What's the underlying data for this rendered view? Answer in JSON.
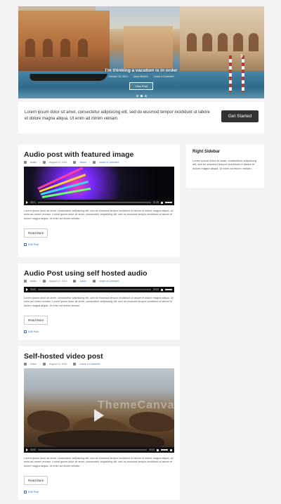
{
  "slider": {
    "title": "I'm thinking a vacation is in order",
    "meta": [
      "October 16, 2014",
      "Jason Bobich",
      "Leave a Comment"
    ],
    "button": "View Post",
    "next_icon": "chevron-right-icon",
    "dots": 3,
    "active_dot": 1
  },
  "cta": {
    "text": "Lorem ipsum dolor sit amet, consectetur adipisicing elit, sed do eiusmod tempor incididunt ut labore et dolore magna aliqua. Ut enim ad minim veniam.",
    "button": "Get Started"
  },
  "posts": [
    {
      "title": "Audio post with featured image",
      "meta": {
        "format": "Audio",
        "date": "August 10, 2014",
        "author": "Jason",
        "comments": "Leave a Comment"
      },
      "player": {
        "current": "00:01",
        "duration": "01:25"
      },
      "excerpt": "Lorem ipsum dolor sit amet, consectetur adipisicing elit, sed do eiusmod tempor incididunt ut labore et dolore magna aliqua. Ut enim ad minim veniam. Lorem ipsum dolor sit amet, consectetur adipisicing elit, sed do eiusmod tempor incididunt ut labore et dolore magna aliqua. Ut enim ad minim veniam.",
      "read_more": "Read More",
      "edit": "Edit Post"
    },
    {
      "title": "Audio Post using self hosted audio",
      "meta": {
        "format": "Audio",
        "date": "August 10, 2014",
        "author": "Jason",
        "comments": "Leave a Comment"
      },
      "player": {
        "current": "00:00",
        "duration": "00:00"
      },
      "excerpt": "Lorem ipsum dolor sit amet, consectetur adipisicing elit, sed do eiusmod tempor incididunt ut labore et dolore magna aliqua. Ut enim ad minim veniam. Lorem ipsum dolor sit amet, consectetur adipisicing elit, sed do eiusmod tempor incididunt ut labore et dolore magna aliqua. Ut enim ad minim veniam.",
      "read_more": "Read More",
      "edit": "Edit Post"
    },
    {
      "title": "Self-hosted video post",
      "meta": {
        "format": "Video",
        "date": "August 10, 2014",
        "author": "",
        "comments": "Leave a Comment"
      },
      "player": {
        "current": "00:00",
        "duration": "00:00"
      },
      "watermark": "ThemeCanvas",
      "excerpt": "Lorem ipsum dolor sit amet, consectetur adipisicing elit, sed do eiusmod tempor incididunt ut labore et dolore magna aliqua. Ut enim ad minim veniam. Lorem ipsum dolor sit amet, consectetur adipisicing elit, sed do eiusmod tempor incididunt ut labore et dolore magna aliqua. Ut enim ad minim veniam.",
      "read_more": "Read More",
      "edit": "Edit Post"
    }
  ],
  "sidebar": {
    "title": "Right Sidebar",
    "text": "Lorem ipsum dolor sit amet, consectetur adipisicing elit, sed do eiusmod tempor incididunt ut labore et dolore magna aliqua. Ut enim ad minim veniam."
  }
}
